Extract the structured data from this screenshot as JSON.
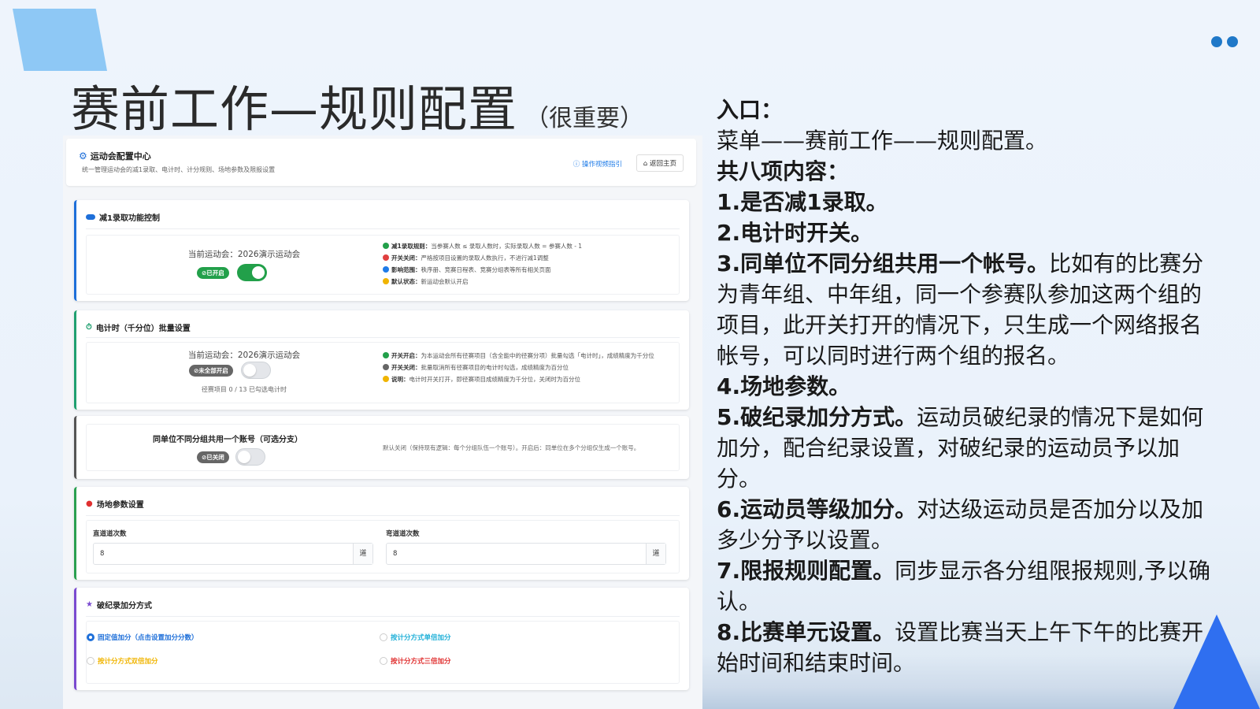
{
  "slide": {
    "title_main": "赛前工作—规则配置",
    "title_sub": "（很重要）"
  },
  "app": {
    "title": "运动会配置中心",
    "description": "统一管理运动会的减1录取、电计时、计分规则、场地参数及限报设置",
    "video_guide": "操作视频指引",
    "home_button": "返回主页"
  },
  "card_reduce": {
    "heading": "减1录取功能控制",
    "meet_label": "当前运动会：2026演示运动会",
    "badge": "已开启",
    "toggle_on": true,
    "rules": [
      {
        "key": "减1录取规则：",
        "text": "当参赛人数 ≤ 录取人数时，实际录取人数 = 参赛人数 - 1",
        "color": "#22a04a"
      },
      {
        "key": "开关关闭：",
        "text": "严格按项目设置的录取人数执行，不进行减1调整",
        "color": "#e04040"
      },
      {
        "key": "影响范围：",
        "text": "秩序册、竞赛日程表、竞赛分组表等所有相关页面",
        "color": "#1e7be8"
      },
      {
        "key": "默认状态：",
        "text": "新运动会默认开启",
        "color": "#f0b400"
      }
    ]
  },
  "card_timing": {
    "heading": "电计时（千分位）批量设置",
    "meet_label": "当前运动会：2026演示运动会",
    "badge": "未全部开启",
    "toggle_on": false,
    "count_text": "径赛项目 0 / 13 已勾选电计时",
    "rules": [
      {
        "key": "开关开启：",
        "text": "为本运动会所有径赛项目（含全能中的径赛分项）批量勾选「电计时」，成绩精度为千分位",
        "color": "#22a04a"
      },
      {
        "key": "开关关闭：",
        "text": "批量取消所有径赛项目的电计时勾选，成绩精度为百分位",
        "color": "#666666"
      },
      {
        "key": "说明：",
        "text": "电计时开关打开，即径赛项目成绩精度为千分位，关闭时为百分位",
        "color": "#f0b400"
      }
    ]
  },
  "card_account": {
    "heading": "同单位不同分组共用一个账号（可选分支）",
    "badge": "已关闭",
    "toggle_on": false,
    "note": "默认关闭（保持现有逻辑：每个分组队伍一个账号）。开启后：同单位在多个分组仅生成一个账号。"
  },
  "card_venue": {
    "heading": "场地参数设置",
    "straight_label": "直道道次数",
    "straight_value": "8",
    "curve_label": "弯道道次数",
    "curve_value": "8",
    "unit": "道"
  },
  "card_record": {
    "heading": "破纪录加分方式",
    "options": [
      {
        "label": "固定值加分（点击设置加分分数）",
        "color": "#1e6fd9",
        "selected": true
      },
      {
        "label": "按计分方式单倍加分",
        "color": "#20b0d8",
        "selected": false
      },
      {
        "label": "按计分方式双倍加分",
        "color": "#f0b400",
        "selected": false
      },
      {
        "label": "按计分方式三倍加分",
        "color": "#e03030",
        "selected": false
      }
    ]
  },
  "content": {
    "entry_title": "入口：",
    "entry_path": "菜单——赛前工作——规则配置。",
    "items_title": "共八项内容：",
    "item1": "1.是否减1录取。",
    "item2": "2.电计时开关。",
    "item3_b": "3.同单位不同分组共用一个帐号。",
    "item3_t": "比如有的比赛分为青年组、中年组，同一个参赛队参加这两个组的项目，此开关打开的情况下，只生成一个网络报名帐号，可以同时进行两个组的报名。",
    "item4": "4.场地参数。",
    "item5_b": "5.破纪录加分方式。",
    "item5_t": "运动员破纪录的情况下是如何加分，配合纪录设置，对破纪录的运动员予以加分。",
    "item6_b": "6.运动员等级加分。",
    "item6_t": "对达级运动员是否加分以及加多少分予以设置。",
    "item7_b": "7.限报规则配置。",
    "item7_t": "同步显示各分组限报规则,予以确认。",
    "item8_b": "8.比赛单元设置。",
    "item8_t": "设置比赛当天上午下午的比赛开始时间和结束时间。"
  },
  "colors": {
    "accent_blue": "#1e6fd9",
    "deco_light_blue": "#8ec8f5",
    "deco_blue": "#2f6ff0"
  }
}
